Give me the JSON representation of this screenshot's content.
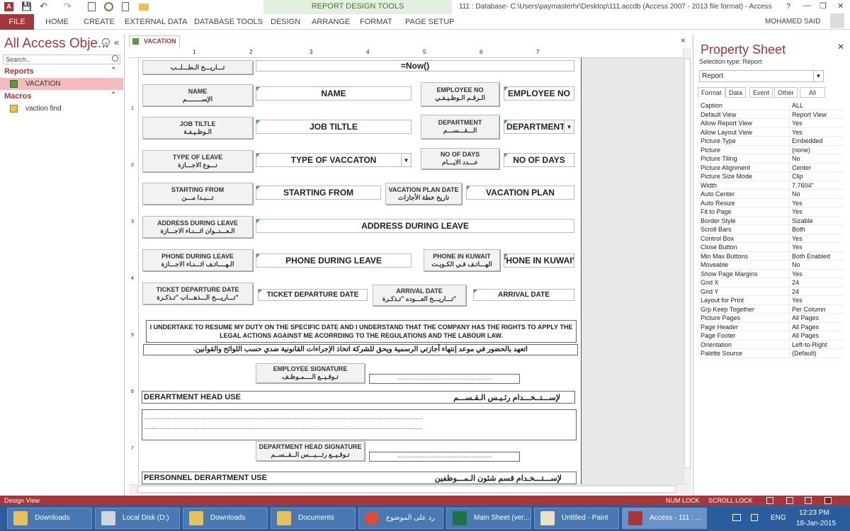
{
  "window": {
    "title": "111 : Database- C:\\Users\\paymasterhr\\Desktop\\111.accdb (Access 2007 - 2013 file format) - Access",
    "help": "?",
    "minimize": "—",
    "restore": "❐",
    "close": "✕",
    "user": "MOHAMED SAID",
    "app_icon": "A"
  },
  "quick_access": {
    "save": "💾",
    "undo": "↶",
    "redo": "↷"
  },
  "ribbon": {
    "file": "FILE",
    "tabs": [
      "HOME",
      "CREATE",
      "EXTERNAL DATA",
      "DATABASE TOOLS",
      "DESIGN",
      "ARRANGE",
      "FORMAT",
      "PAGE SETUP"
    ],
    "context_group": "REPORT DESIGN TOOLS"
  },
  "nav": {
    "title": "All Access Obje...",
    "search_placeholder": "Search...",
    "group_reports": "Reports",
    "group_macros": "Macros",
    "reports": [
      "VACATION"
    ],
    "macros": [
      "vaction find"
    ],
    "collapse": "«",
    "menu": "⌄",
    "chevron": "⌃"
  },
  "doc": {
    "tab_label": "VACATION",
    "close": "×"
  },
  "ruler": {
    "numbers": [
      "1",
      "2",
      "3",
      "4",
      "5",
      "6",
      "7"
    ]
  },
  "form": {
    "row0_label": "تـــاريـــخ الـطـــلــب",
    "now": "=Now()",
    "name_label_en": "NAME",
    "name_label_ar": "الإســــــــم",
    "name_field": "NAME",
    "empno_label_en": "EMPLOYEE NO",
    "empno_label_ar": "الـرقـم الـوظـيـفـي",
    "empno_field": "EMPLOYEE NO",
    "job_label_en": "JOB TILTLE",
    "job_label_ar": "الـوظـيـفـة",
    "job_field": "JOB TILTLE",
    "dept_label_en": "DEPARTMENT",
    "dept_label_ar": "الـــقـــســـم",
    "dept_field": "DEPARTMENT",
    "type_label_en": "TYPE OF LEAVE",
    "type_label_ar": "نـــوع الاجـــازة",
    "type_field": "TYPE OF VACCATON",
    "days_label_en": "NO OF DAYS",
    "days_label_ar": "عـــدد الايـــام",
    "days_field": "NO OF DAYS",
    "start_label_en": "STARTING FROM",
    "start_label_ar": "تـــبـدا مـــن",
    "start_field": "STARTING FROM",
    "plan_label_en": "VACATION PLAN DATE",
    "plan_label_ar": "تاريخ خطة الأجازات",
    "plan_field": "VACATION PLAN",
    "addr_label_en": "ADDRESS DURING LEAVE",
    "addr_label_ar": "الـعـــنــوان اثـــنـاء الاجـــازة",
    "addr_field": "ADDRESS DURING LEAVE",
    "phone_label_en": "PHONE DURING LEAVE",
    "phone_label_ar": "الـهــــاتـف اثـــنـاء الاجـــازة",
    "phone_field": "PHONE DURING LEAVE",
    "kuwait_label_en": "PHONE IN KUWAIT",
    "kuwait_label_ar": "الهـــاتـف فـي الكـويـت",
    "kuwait_field": "'HONE IN KUWAI'",
    "ticket_label_en": "TICKET DEPARTURE DATE",
    "ticket_label_ar": "تـــاريـــخ الـــذهـــاب \"تـذكـرة\"",
    "ticket_field": "TICKET DEPARTURE DATE",
    "arrival_label_en": "ARRIVAL DATE",
    "arrival_label_ar": "تـــاريـــخ العـــوده \"تـذكـرة\"",
    "arrival_field": "ARRIVAL DATE",
    "undertake_en": "I UNDERTAKE TO RESUME MY DUTY ON THE SPECIFIC DATE AND I UNDERSTAND THAT THE COMPANY HAS THE RIGHTS TO APPLY THE LEGAL ACTIONS AGAINST ME ACORRDING TO THE REGULATIONS AND THE LABOUR LAW.",
    "undertake_ar": "اتعهد بالحضور في موعد إنتهاء أجازتي الرسمية ويحق للشركة اتخاذ الإجراءات القانونية ضدي حسب اللوائح والقوانين.",
    "sig_label_en": "EMPLOYEE SIGNATURE",
    "sig_label_ar": "تـوقـيــع الــــمـوظـف",
    "dots": "............................................................",
    "dept_head_en": "DERARTMENT HEAD USE",
    "dept_head_ar": "لإســـتــخـــدام رئـيـس الـقـســـم",
    "long_dots": ".................................................................................................................................................................................",
    "dh_sig_en": "DEPARTMENT HEAD SIGNATURE",
    "dh_sig_ar": "تـوقـيــع رئـــيـــس الــقــســم",
    "personnel_en": "PERSONNEL DERARTMENT USE",
    "personnel_ar": "لإســـتـــخـدام قسم شئون الـمـــوظفين"
  },
  "props": {
    "title": "Property Sheet",
    "close": "✕",
    "selection_type": "Selection type:  Report",
    "combo": "Report",
    "tabs": [
      "Format",
      "Data",
      "Event",
      "Other",
      "All"
    ],
    "rows": [
      [
        "Caption",
        "ALL"
      ],
      [
        "Default View",
        "Report View"
      ],
      [
        "Allow Report View",
        "Yes"
      ],
      [
        "Allow Layout View",
        "Yes"
      ],
      [
        "Picture Type",
        "Embedded"
      ],
      [
        "Picture",
        "(none)"
      ],
      [
        "Picture Tiling",
        "No"
      ],
      [
        "Picture Alignment",
        "Center"
      ],
      [
        "Picture Size Mode",
        "Clip"
      ],
      [
        "Width",
        "7.7604\""
      ],
      [
        "Auto Center",
        "No"
      ],
      [
        "Auto Resize",
        "Yes"
      ],
      [
        "Fit to Page",
        "Yes"
      ],
      [
        "Border Style",
        "Sizable"
      ],
      [
        "Scroll Bars",
        "Both"
      ],
      [
        "Control Box",
        "Yes"
      ],
      [
        "Close Button",
        "Yes"
      ],
      [
        "Min Max Buttons",
        "Both Enabled"
      ],
      [
        "Moveable",
        "No"
      ],
      [
        "Show Page Margins",
        "Yes"
      ],
      [
        "Grid X",
        "24"
      ],
      [
        "Grid Y",
        "24"
      ],
      [
        "Layout for Print",
        "Yes"
      ],
      [
        "Grp Keep Together",
        "Per Column"
      ],
      [
        "Picture Pages",
        "All Pages"
      ],
      [
        "Page Header",
        "All Pages"
      ],
      [
        "Page Footer",
        "All Pages"
      ],
      [
        "Orientation",
        "Left-to-Right"
      ],
      [
        "Palette Source",
        "(Default)"
      ]
    ]
  },
  "status": {
    "left": "Design View",
    "num_lock": "NUM LOCK",
    "scroll_lock": "SCROLL LOCK"
  },
  "taskbar": {
    "buttons": [
      "Downloads",
      "Local Disk (D:)",
      "Downloads",
      "Documents",
      "رد على الموضوع",
      "Main Sheet (ver...",
      "Untitled - Paint",
      "Access - 111 : ..."
    ],
    "lang": "ENG",
    "time": "12:23 PM",
    "date": "18-Jan-2015"
  },
  "colors": {
    "access_red": "#a4373a",
    "context_green": "#e3f0e0",
    "taskbar_blue": "#2b5d9d"
  }
}
